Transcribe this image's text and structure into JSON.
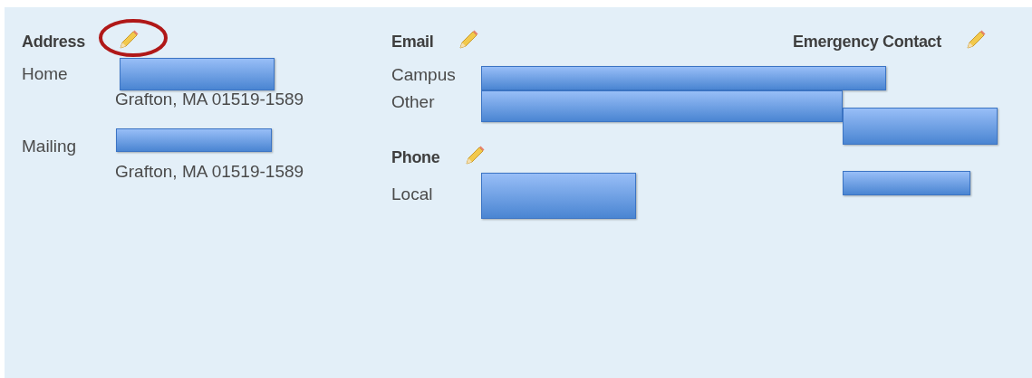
{
  "sections": [
    {
      "kind": "address",
      "title": "Address",
      "edit_highlighted": true,
      "rows": [
        {
          "label": "Home",
          "lines": [
            "Grafton, MA 01519-1589"
          ]
        },
        {
          "label": "Mailing",
          "lines": [
            "Grafton, MA 01519-1589"
          ]
        }
      ]
    },
    {
      "kind": "list",
      "title": "Email",
      "edit_highlighted": false,
      "rows": [
        {
          "label": "Campus"
        },
        {
          "label": "Other"
        }
      ]
    },
    {
      "kind": "list",
      "title": "Phone",
      "edit_highlighted": false,
      "rows": [
        {
          "label": "Local"
        }
      ]
    },
    {
      "kind": "contact",
      "title": "Emergency Contact",
      "edit_highlighted": false
    }
  ]
}
